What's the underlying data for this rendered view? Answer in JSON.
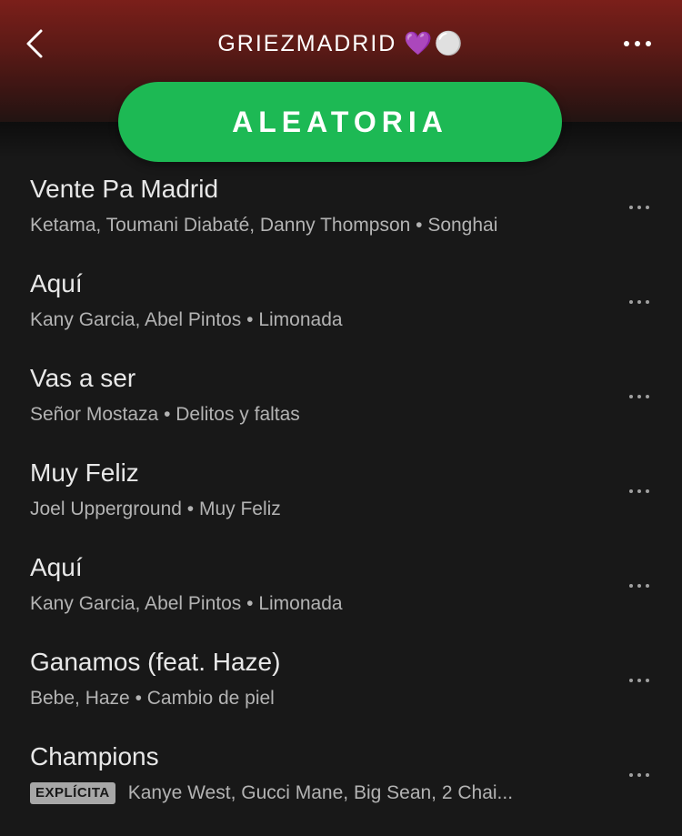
{
  "header": {
    "title": "GRIEZMADRID",
    "title_emoji": "💜⚪",
    "back_icon": "chevron-left-icon",
    "more_icon": "more-horizontal-icon",
    "gradient_top": "#7b1f1a"
  },
  "shuffle": {
    "label": "ALEATORIA",
    "color": "#1db954"
  },
  "tracks": [
    {
      "title": "Vente Pa Madrid",
      "subtitle": "Ketama, Toumani Diabaté, Danny Thompson • Songhai",
      "explicit": ""
    },
    {
      "title": "Aquí",
      "subtitle": "Kany Garcia, Abel Pintos • Limonada",
      "explicit": ""
    },
    {
      "title": "Vas a ser",
      "subtitle": "Señor Mostaza • Delitos y faltas",
      "explicit": ""
    },
    {
      "title": "Muy Feliz",
      "subtitle": "Joel Upperground • Muy Feliz",
      "explicit": ""
    },
    {
      "title": "Aquí",
      "subtitle": "Kany Garcia, Abel Pintos • Limonada",
      "explicit": ""
    },
    {
      "title": "Ganamos (feat. Haze)",
      "subtitle": "Bebe, Haze • Cambio de piel",
      "explicit": ""
    },
    {
      "title": "Champions",
      "subtitle": "Kanye West, Gucci Mane, Big Sean, 2 Chai...",
      "explicit": "EXPLÍCITA"
    }
  ]
}
